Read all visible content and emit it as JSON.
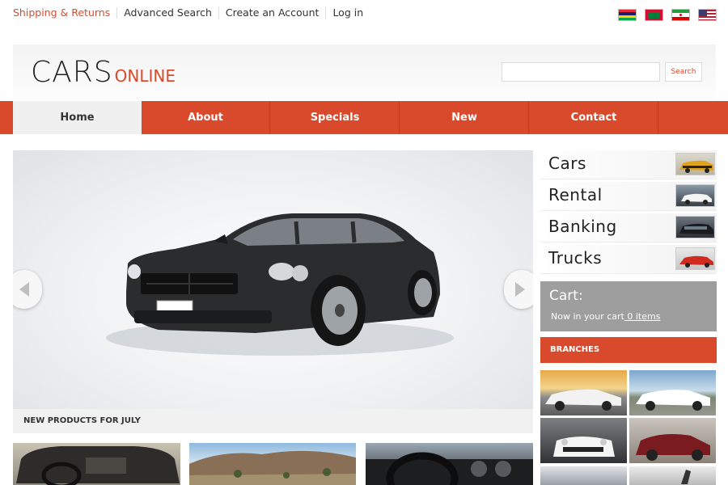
{
  "top_links": {
    "shipping": "Shipping & Returns",
    "advanced_search": "Advanced Search",
    "create_account": "Create an Account",
    "login": "Log in"
  },
  "flags": [
    "mauritius-flag-icon",
    "maldives-flag-icon",
    "iran-flag-icon",
    "usa-flag-icon"
  ],
  "logo": {
    "main": "CARS",
    "sub": "ONLINE"
  },
  "search": {
    "placeholder": "",
    "button": "Search"
  },
  "nav": {
    "items": [
      {
        "label": "Home",
        "active": true
      },
      {
        "label": "About"
      },
      {
        "label": "Specials"
      },
      {
        "label": "New"
      },
      {
        "label": "Contact"
      }
    ]
  },
  "slider": {
    "prev_icon": "arrow-left-icon",
    "next_icon": "arrow-right-icon"
  },
  "new_products": {
    "title": "NEW PRODUCTS FOR JULY"
  },
  "categories": [
    {
      "label": "Cars"
    },
    {
      "label": "Rental"
    },
    {
      "label": "Banking"
    },
    {
      "label": "Trucks"
    }
  ],
  "cart": {
    "title": "Cart:",
    "line_prefix": "Now in your cart",
    "line_link": " 0 items"
  },
  "branches": {
    "title": "BRANCHES"
  },
  "colors": {
    "accent": "#d94a2c",
    "cart_bg": "#9e9e9e",
    "nav_active_bg": "#f0f0f0"
  }
}
